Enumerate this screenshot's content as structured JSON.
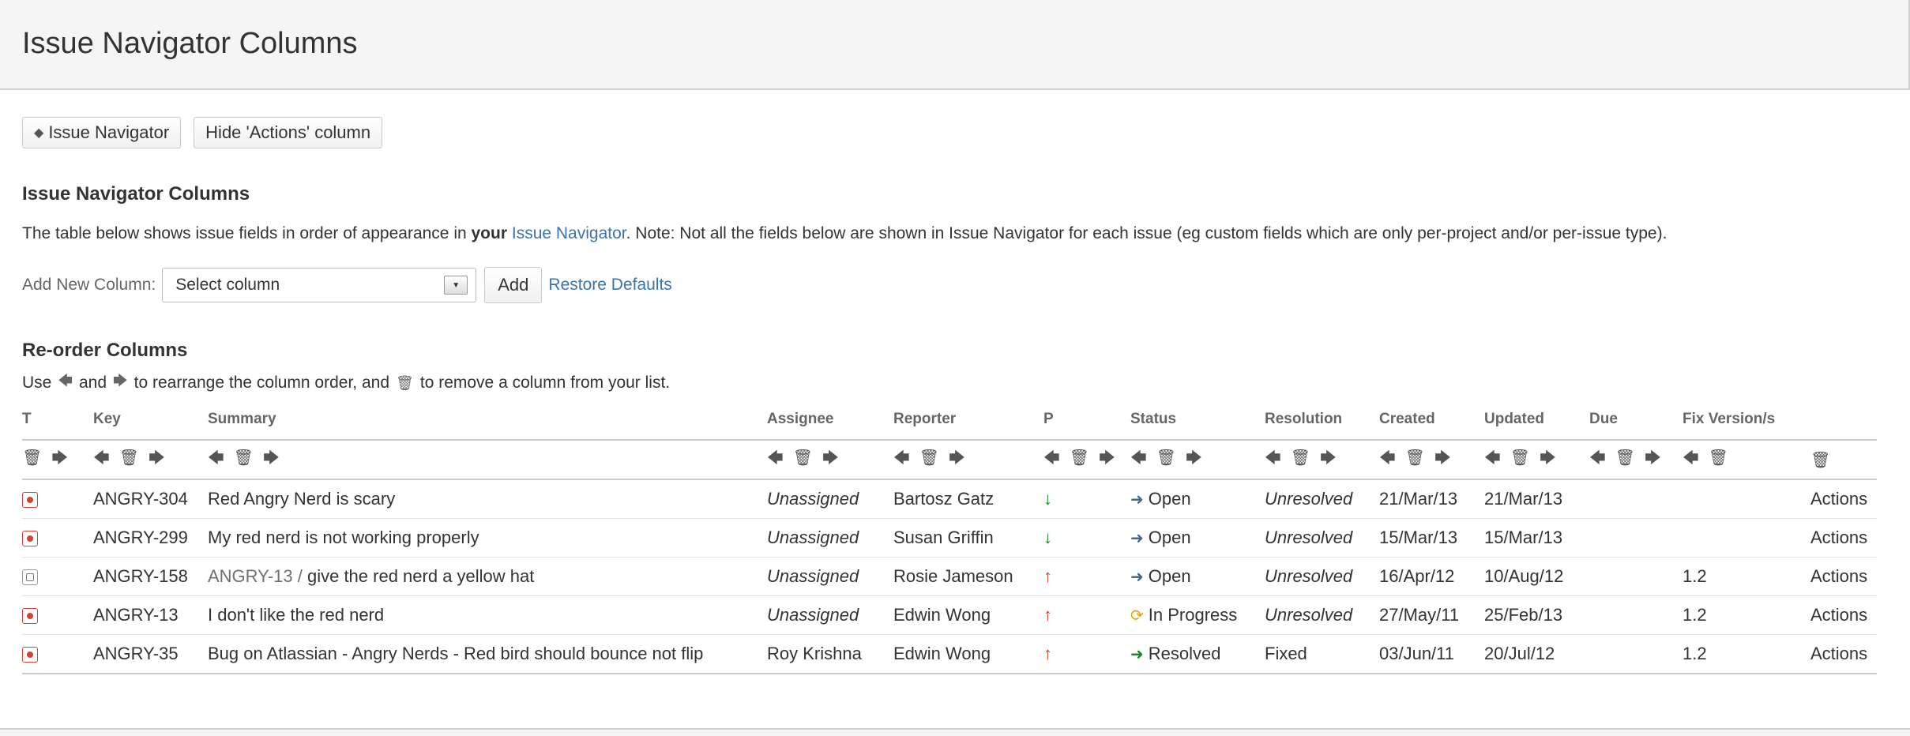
{
  "header": {
    "title": "Issue Navigator Columns"
  },
  "buttons": {
    "back": "Issue Navigator",
    "hide_actions": "Hide 'Actions' column"
  },
  "section1": {
    "title": "Issue Navigator Columns",
    "desc_part1": "The table below shows issue fields in order of appearance in ",
    "desc_bold": "your",
    "desc_link": "Issue Navigator",
    "desc_part2": ". Note: Not all the fields below are shown in Issue Navigator for each issue (eg custom fields which are only per-project and/or per-issue type)."
  },
  "add_column": {
    "label": "Add New Column:",
    "select_value": "Select column",
    "add_button": "Add",
    "restore_link": "Restore Defaults"
  },
  "section2": {
    "title": "Re-order Columns",
    "instr_use": "Use",
    "instr_and": "and",
    "instr_rearrange": "to rearrange the column order, and",
    "instr_remove": "to remove a column from your list."
  },
  "table": {
    "headers": [
      "T",
      "Key",
      "Summary",
      "Assignee",
      "Reporter",
      "P",
      "Status",
      "Resolution",
      "Created",
      "Updated",
      "Due",
      "Fix Version/s",
      ""
    ],
    "rows": [
      {
        "type": "bug",
        "key": "ANGRY-304",
        "parent": "",
        "summary": "Red Angry Nerd is scary",
        "assignee": "Unassigned",
        "reporter": "Bartosz Gatz",
        "priority": "down",
        "status": "Open",
        "status_icon": "open",
        "resolution": "Unresolved",
        "created": "21/Mar/13",
        "updated": "21/Mar/13",
        "due": "",
        "fix": "",
        "actions": "Actions"
      },
      {
        "type": "bug",
        "key": "ANGRY-299",
        "parent": "",
        "summary": "My red nerd is not working properly",
        "assignee": "Unassigned",
        "reporter": "Susan Griffin",
        "priority": "down",
        "status": "Open",
        "status_icon": "open",
        "resolution": "Unresolved",
        "created": "15/Mar/13",
        "updated": "15/Mar/13",
        "due": "",
        "fix": "",
        "actions": "Actions"
      },
      {
        "type": "subtask",
        "key": "ANGRY-158",
        "parent": "ANGRY-13 /",
        "summary": "give the red nerd a yellow hat",
        "assignee": "Unassigned",
        "reporter": "Rosie Jameson",
        "priority": "up",
        "status": "Open",
        "status_icon": "open",
        "resolution": "Unresolved",
        "created": "16/Apr/12",
        "updated": "10/Aug/12",
        "due": "",
        "fix": "1.2",
        "actions": "Actions"
      },
      {
        "type": "bug",
        "key": "ANGRY-13",
        "parent": "",
        "summary": "I don't like the red nerd",
        "assignee": "Unassigned",
        "reporter": "Edwin Wong",
        "priority": "up",
        "status": "In Progress",
        "status_icon": "progress",
        "resolution": "Unresolved",
        "created": "27/May/11",
        "updated": "25/Feb/13",
        "due": "",
        "fix": "1.2",
        "actions": "Actions"
      },
      {
        "type": "bug",
        "key": "ANGRY-35",
        "parent": "",
        "summary": "Bug on Atlassian - Angry Nerds - Red bird should bounce not flip",
        "assignee": "Roy Krishna",
        "reporter": "Edwin Wong",
        "priority": "up",
        "status": "Resolved",
        "status_icon": "resolved",
        "resolution": "Fixed",
        "created": "03/Jun/11",
        "updated": "20/Jul/12",
        "due": "",
        "fix": "1.2",
        "actions": "Actions"
      }
    ]
  },
  "icons": {
    "left_arrow": "arrow-left-icon",
    "right_arrow": "arrow-right-icon",
    "trash": "trash-icon"
  },
  "colors": {
    "link": "#3b73af",
    "priority_low": "#14892c",
    "priority_high": "#d04437",
    "bug": "#d04437"
  }
}
